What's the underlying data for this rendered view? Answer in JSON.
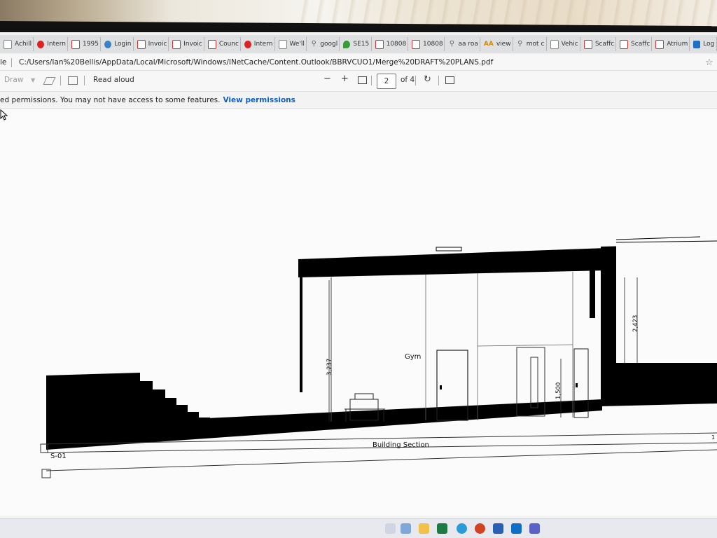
{
  "browser": {
    "tabs": [
      {
        "label": "Achill",
        "icon": "page-icon"
      },
      {
        "label": "Intern",
        "icon": "red-circle-icon"
      },
      {
        "label": "1995",
        "icon": "pdf-icon"
      },
      {
        "label": "Login",
        "icon": "blue-circle-icon"
      },
      {
        "label": "Invoic",
        "icon": "pdf-icon"
      },
      {
        "label": "Invoic",
        "icon": "pdf-icon"
      },
      {
        "label": "Counc",
        "icon": "pdf-icon"
      },
      {
        "label": "Intern",
        "icon": "red-circle-icon"
      },
      {
        "label": "We'll",
        "icon": "page-icon"
      },
      {
        "label": "googl",
        "icon": "search-icon"
      },
      {
        "label": "SE15",
        "icon": "map-pin-icon"
      },
      {
        "label": "10808",
        "icon": "pdf-icon"
      },
      {
        "label": "10808",
        "icon": "pdf-icon"
      },
      {
        "label": "aa roa",
        "icon": "search-icon"
      },
      {
        "label": "view",
        "icon": "aa-icon"
      },
      {
        "label": "mot c",
        "icon": "search-icon"
      },
      {
        "label": "Vehic",
        "icon": "page-icon"
      },
      {
        "label": "Scaffc",
        "icon": "pdf-icon"
      },
      {
        "label": "Scaffc",
        "icon": "pdf-icon"
      },
      {
        "label": "Atrium",
        "icon": "pdf-icon"
      },
      {
        "label": "Log",
        "icon": "windows-icon"
      }
    ],
    "address": {
      "prefix": "le",
      "url": "C:/Users/Ian%20Bellis/AppData/Local/Microsoft/Windows/INetCache/Content.Outlook/BBRVCUO1/Merge%20DRAFT%20PLANS.pdf"
    }
  },
  "pdf_toolbar": {
    "draw_label": "Draw",
    "read_aloud_label": "Read aloud",
    "zoom_out": "−",
    "zoom_in": "+",
    "current_page": "2",
    "page_of": "of 4"
  },
  "info_bar": {
    "message": "ed permissions. You may not have access to some features.",
    "link": "View permissions"
  },
  "drawing": {
    "room_label": "Gym",
    "section_title": "Building Section",
    "section_ref": "S-01",
    "dim_height": "3,237",
    "dim_door": "1,500",
    "dim_right": "2,423",
    "edge_mark": "1"
  }
}
